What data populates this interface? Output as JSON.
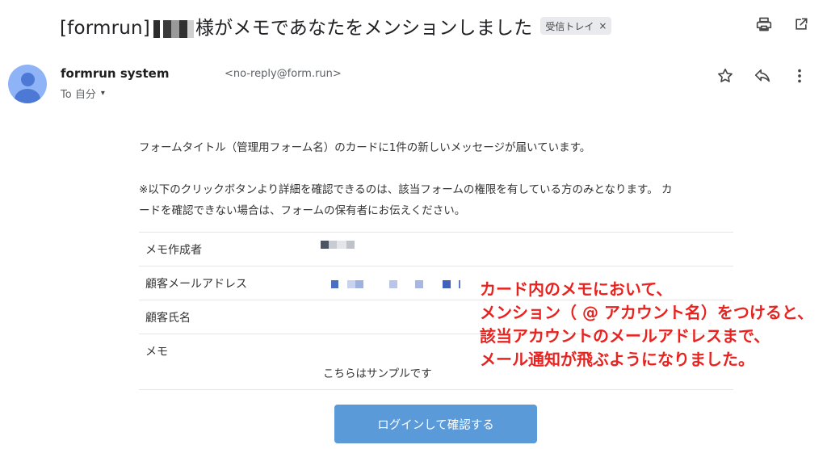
{
  "subject": {
    "prefix": "[formrun]",
    "text": "様がメモであなたをメンションしました",
    "label": "受信トレイ",
    "label_close": "×"
  },
  "toolbar": {
    "print_icon": "print-icon",
    "open_new_window_icon": "open-in-new-icon"
  },
  "sender": {
    "name": "formrun system",
    "email": "<no-reply@form.run>",
    "to": "To 自分",
    "to_caret": "▾"
  },
  "message_actions": {
    "star_icon": "star-icon",
    "reply_icon": "reply-icon",
    "more_icon": "more-vert-icon"
  },
  "body": {
    "intro": "フォームタイトル（管理用フォーム名）のカードに1件の新しいメッセージが届いています。",
    "note_line1": "※以下のクリックボタンより詳細を確認できるのは、該当フォームの権限を有している方のみとなります。 カ",
    "note_line2": "ードを確認できない場合は、フォームの保有者にお伝えください。",
    "rows": [
      {
        "label": "メモ作成者",
        "value": ""
      },
      {
        "label": "顧客メールアドレス",
        "value": ""
      },
      {
        "label": "顧客氏名",
        "value": ""
      },
      {
        "label": "メモ",
        "value": "こちらはサンプルです"
      }
    ],
    "button": "ログインして確認する"
  },
  "annotation": {
    "lines": [
      "カード内のメモにおいて、",
      "メンション（ @ アカウント名）をつけると、",
      "該当アカウントのメールアドレスまで、",
      "メール通知が飛ぶようになりました。"
    ]
  },
  "colors": {
    "button": "#5a9ad9",
    "annotation": "#e8231f",
    "avatar": "#8fb3f7"
  }
}
